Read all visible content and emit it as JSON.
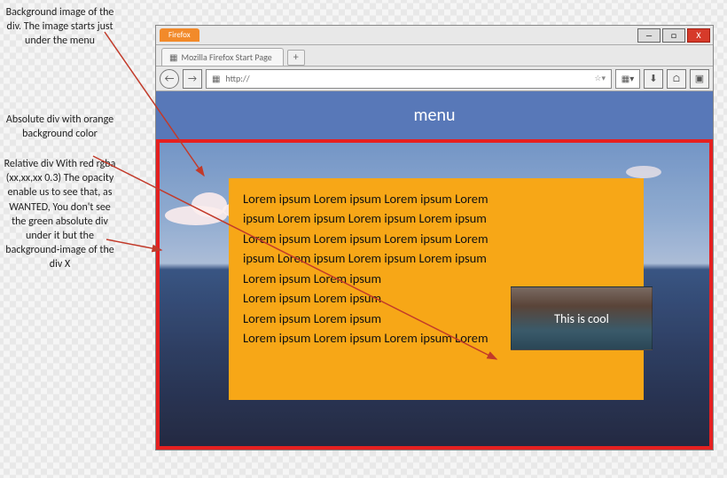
{
  "annotations": {
    "a1": "Background image of the div. The image starts just under the menu",
    "a2": "Absolute div with orange background color",
    "a3": "Relative div With red rgba (xx,xx,xx 0.3) The opacity enable us to see that, as WANTED, You don't see the green absolute div under it but the background-image of the div X"
  },
  "browser": {
    "app": "Firefox",
    "tab_title": "Mozilla Firefox Start Page",
    "url_scheme": "http://",
    "minimize": "―",
    "maximize": "□",
    "close": "X",
    "plus": "+",
    "back": "←",
    "forward": "→",
    "home": "⌂"
  },
  "page": {
    "menu_label": "menu",
    "lorem": [
      "Lorem ipsum Lorem ipsum Lorem ipsum Lorem",
      "ipsum Lorem ipsum Lorem ipsum Lorem ipsum",
      "Lorem ipsum Lorem ipsum Lorem ipsum Lorem",
      "ipsum Lorem ipsum Lorem ipsum Lorem ipsum",
      "Lorem ipsum Lorem ipsum",
      "Lorem ipsum Lorem ipsum",
      "Lorem ipsum Lorem ipsum",
      "Lorem ipsum Lorem ipsum Lorem ipsum Lorem"
    ],
    "cool_caption": "This is cool"
  },
  "colors": {
    "menu_bg": "#5878b8",
    "orange_bg": "#f7a717",
    "red_border": "#e52020",
    "firefox_orange": "#f28a2a",
    "close_red": "#d63a2a"
  }
}
